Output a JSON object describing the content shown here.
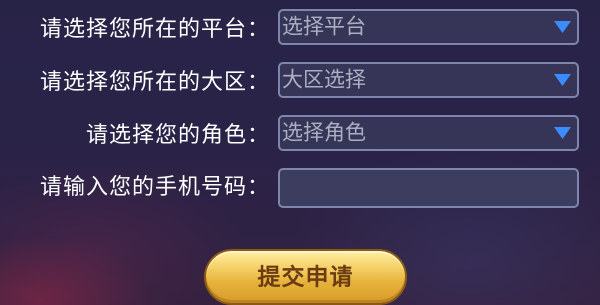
{
  "form": {
    "platform": {
      "label": "请选择您所在的平台：",
      "value": "选择平台",
      "icon": "triangle-down-icon"
    },
    "region": {
      "label": "请选择您所在的大区：",
      "value": "大区选择",
      "icon": "triangle-down-icon"
    },
    "role": {
      "label": "请选择您的角色：",
      "value": "选择角色",
      "icon": "triangle-down-icon"
    },
    "phone": {
      "label": "请输入您的手机号码：",
      "value": ""
    },
    "submit_label": "提交申请"
  },
  "colors": {
    "label_text": "#ffffff",
    "field_text": "#aab0c2",
    "field_border": "#7f86ad",
    "field_bg": "#363558",
    "arrow": "#3a8cff",
    "submit_gold": "#e8b43d",
    "submit_text": "#6b3c12"
  }
}
